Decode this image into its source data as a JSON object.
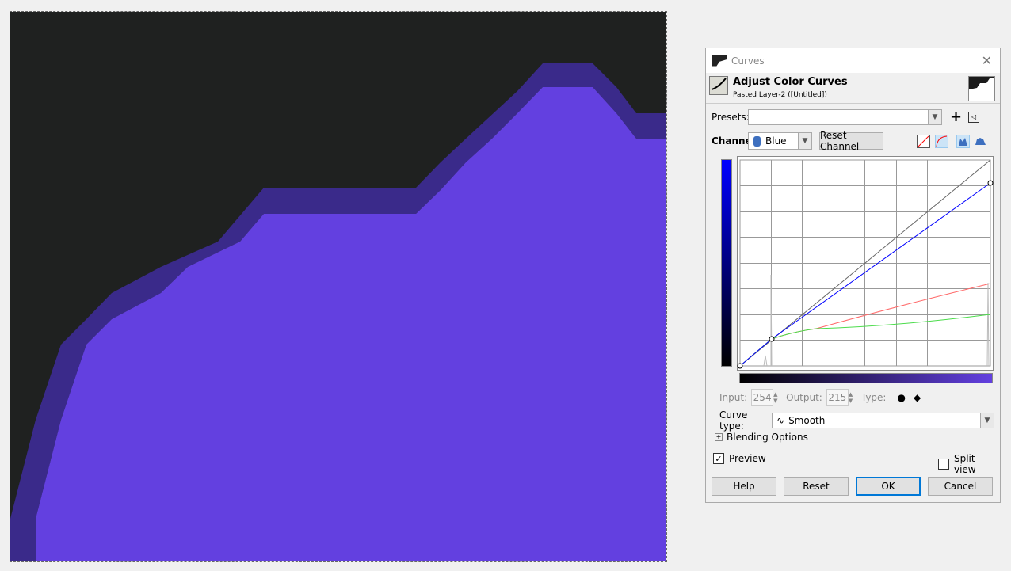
{
  "dialog": {
    "title": "Curves",
    "header_title": "Adjust Color Curves",
    "header_subtitle": "Pasted Layer-2 ([Untitled])"
  },
  "presets": {
    "label": "Presets:",
    "value": ""
  },
  "channel": {
    "label": "Channel:",
    "value": "Blue",
    "reset_label": "Reset Channel"
  },
  "point": {
    "input_label": "Input:",
    "input_value": "254",
    "output_label": "Output:",
    "output_value": "215",
    "type_label": "Type:"
  },
  "curve_type": {
    "label": "Curve type:",
    "value": "Smooth"
  },
  "blending": {
    "label": "Blending Options"
  },
  "preview": {
    "label": "Preview",
    "checked": true
  },
  "split_view": {
    "label": "Split view",
    "checked": false
  },
  "buttons": {
    "help": "Help",
    "reset": "Reset",
    "ok": "OK",
    "cancel": "Cancel"
  },
  "colors": {
    "canvas_dark": "#1f2120",
    "canvas_purple": "#6340e0",
    "blue_curve": "#0000ff",
    "red_curve": "#ff6a6a",
    "green_curve": "#4cdc4c",
    "accent": "#0078d7"
  }
}
